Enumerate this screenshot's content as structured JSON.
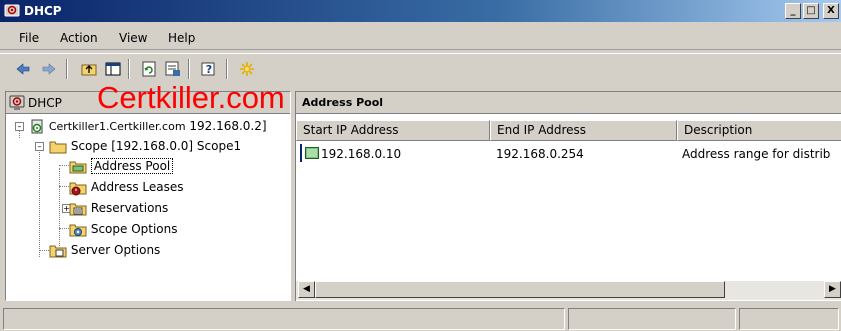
{
  "window": {
    "title": "DHCP",
    "minimize_label": "_",
    "maximize_label": "□",
    "close_label": "X"
  },
  "menu": {
    "file": "File",
    "action": "Action",
    "view": "View",
    "help": "Help"
  },
  "toolbar": {
    "icons": [
      "back-arrow-icon",
      "forward-arrow-icon",
      "up-one-level-icon",
      "show-hide-console-tree-icon",
      "refresh-icon",
      "export-list-icon",
      "help-icon",
      "add-server-icon"
    ]
  },
  "watermark": "Certkiller.com",
  "tree": {
    "root_label": "DHCP",
    "server_label": "Certkiller1.Certkiller.com",
    "server_ip": "192.168.0.2]",
    "scope_label": "Scope [192.168.0.0] Scope1",
    "items": [
      {
        "label": "Address Pool",
        "icon": "address-pool-icon"
      },
      {
        "label": "Address Leases",
        "icon": "address-leases-icon"
      },
      {
        "label": "Reservations",
        "icon": "reservations-icon"
      },
      {
        "label": "Scope Options",
        "icon": "scope-options-icon"
      }
    ],
    "server_options_label": "Server Options"
  },
  "right_pane": {
    "title": "Address Pool",
    "title_prefix_visible": "ddress Pool",
    "columns": [
      "Start IP Address",
      "End IP Address",
      "Description"
    ],
    "rows": [
      {
        "start": "192.168.0.10",
        "end": "192.168.0.254",
        "description": "Address range for distrib"
      }
    ]
  },
  "colors": {
    "title_bar_start": "#0a246a",
    "title_bar_end": "#a6caf0",
    "face": "#d4d0c8",
    "watermark": "#ff0000"
  }
}
